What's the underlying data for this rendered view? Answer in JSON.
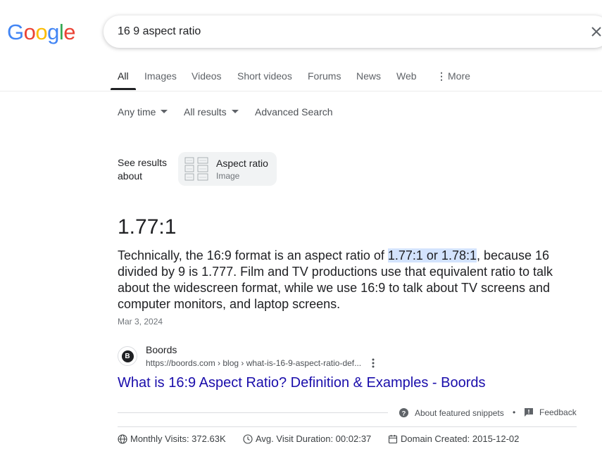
{
  "logo": {
    "letters": [
      "G",
      "o",
      "o",
      "g",
      "l",
      "e"
    ],
    "colors": [
      "#4285F4",
      "#EA4335",
      "#FBBC05",
      "#4285F4",
      "#34A853",
      "#EA4335"
    ]
  },
  "search": {
    "query": "16 9 aspect ratio",
    "clear_icon": "close-icon"
  },
  "tabs": [
    {
      "label": "All",
      "active": true
    },
    {
      "label": "Images"
    },
    {
      "label": "Videos"
    },
    {
      "label": "Short videos"
    },
    {
      "label": "Forums"
    },
    {
      "label": "News"
    },
    {
      "label": "Web"
    },
    {
      "label": "More",
      "icon": "more-vert-icon"
    }
  ],
  "tools": {
    "time": "Any time",
    "results": "All results",
    "advanced": "Advanced Search"
  },
  "see_results": {
    "label_line1": "See results",
    "label_line2": "about",
    "chip_title": "Aspect ratio",
    "chip_subtitle": "Image"
  },
  "featured": {
    "answer": "1.77:1",
    "text_before": "Technically, the 16:9 format is an aspect ratio of ",
    "highlight": "1.77:1 or 1.78:1",
    "text_after": ", because 16 divided by 9 is 1.777. Film and TV productions use that equivalent ratio to talk about the widescreen format, while we use 16:9 to talk about TV screens and computer monitors, and laptop screens.",
    "date": "Mar 3, 2024",
    "highlight_color": "#d3e3fd"
  },
  "source": {
    "favicon_letter": "B",
    "site_name": "Boords",
    "url": "https://boords.com › blog › what-is-16-9-aspect-ratio-def...",
    "title": "What is 16:9 Aspect Ratio? Definition & Examples - Boords",
    "link_color": "#1a0dab"
  },
  "feedback": {
    "about_label": "About featured snippets",
    "separator": "•",
    "feedback_label": "Feedback"
  },
  "stats": {
    "monthly_visits": "Monthly Visits: 372.63K",
    "avg_duration": "Avg. Visit Duration: 00:02:37",
    "domain_created": "Domain Created: 2015-12-02"
  }
}
